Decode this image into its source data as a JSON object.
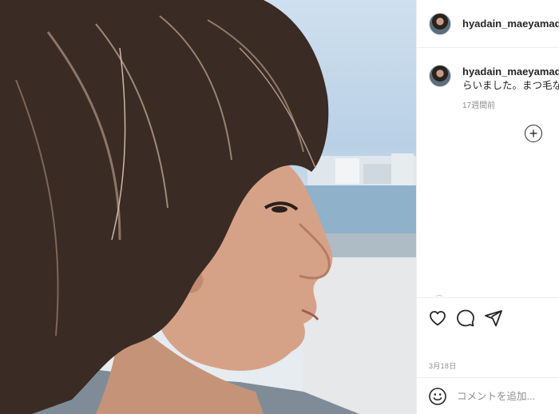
{
  "post": {
    "username": "hyadain_maeyamada",
    "photo_label": "post-photo"
  },
  "caption": {
    "username": "hyadain_maeyamada",
    "text_prefix": "",
    "text": "らいました。まつ毛な",
    "time_ago": "17週間前"
  },
  "comments": {
    "load_more_symbol": "+"
  },
  "actions": {
    "like_icon": "heart-icon",
    "comment_icon": "comment-icon",
    "share_icon": "paper-plane-icon"
  },
  "date": "3月18日",
  "add_comment": {
    "placeholder": "コメントを追加..."
  }
}
